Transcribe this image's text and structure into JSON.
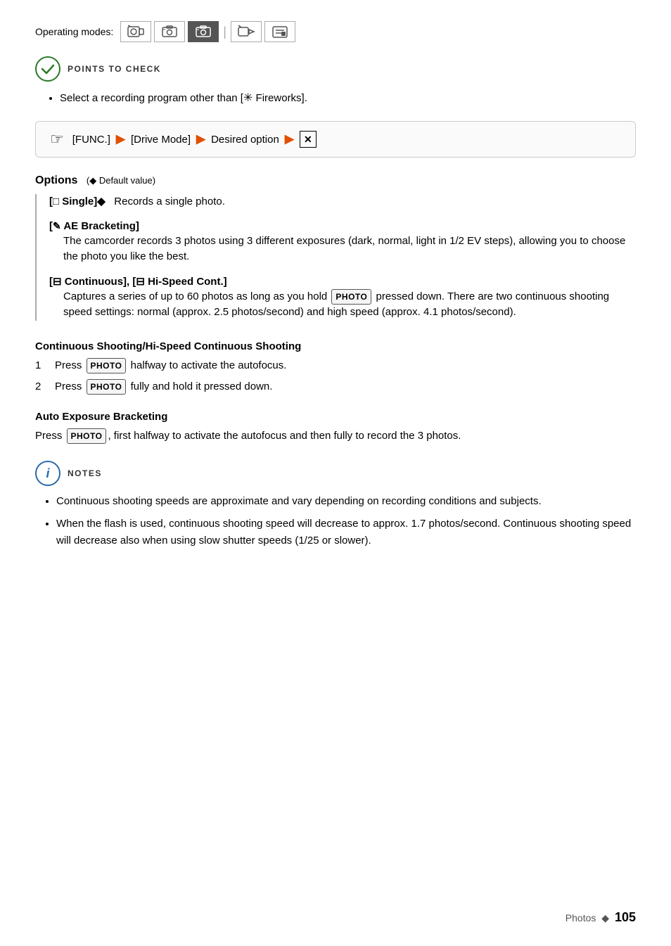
{
  "operatingModes": {
    "label": "Operating modes:",
    "modes": [
      {
        "id": "mode1",
        "symbol": "🎥",
        "active": false
      },
      {
        "id": "mode2",
        "symbol": "📷",
        "active": false
      },
      {
        "id": "mode3",
        "symbol": "📷",
        "active": true
      },
      {
        "id": "mode4",
        "symbol": "🎬",
        "active": false
      },
      {
        "id": "mode5",
        "symbol": "📁",
        "active": false
      }
    ]
  },
  "pointsToCheck": {
    "label": "POINTS TO CHECK"
  },
  "bulletSection": {
    "item": "Select a recording program other than [✳ Fireworks]."
  },
  "navPath": {
    "func": "[FUNC.]",
    "driveMode": "[Drive Mode]",
    "desiredOption": "Desired option",
    "close": "✕"
  },
  "options": {
    "header": "Options",
    "defaultNote": "(◆ Default value)",
    "items": [
      {
        "label": "[□ Single]◆",
        "desc": "Records a single photo."
      },
      {
        "label": "[✎ AE Bracketing]",
        "desc": "The camcorder records 3 photos using 3 different exposures (dark, normal, light in 1/2 EV steps), allowing you to choose the photo you like the best."
      },
      {
        "label": "[⊟ Continuous], [⊟ Hi-Speed Cont.]",
        "desc": "Captures a series of up to 60 photos as long as you hold PHOTO pressed down. There are two continuous shooting speed settings: normal (approx. 2.5 photos/second) and high speed (approx. 4.1 photos/second)."
      }
    ]
  },
  "continuousShooting": {
    "heading": "Continuous Shooting/Hi-Speed Continuous Shooting",
    "steps": [
      "Press PHOTO halfway to activate the autofocus.",
      "Press PHOTO fully and hold it pressed down."
    ]
  },
  "autoExposure": {
    "heading": "Auto Exposure Bracketing",
    "desc": "Press PHOTO, first halfway to activate the autofocus and then fully to record the 3 photos."
  },
  "notes": {
    "label": "NOTES",
    "items": [
      "Continuous shooting speeds are approximate and vary depending on recording conditions and subjects.",
      "When the flash is used, continuous shooting speed will decrease to approx. 1.7 photos/second. Continuous shooting speed will decrease also when using slow shutter speeds (1/25 or slower)."
    ]
  },
  "footer": {
    "text": "Photos",
    "diamond": "◆",
    "pageNumber": "105"
  }
}
